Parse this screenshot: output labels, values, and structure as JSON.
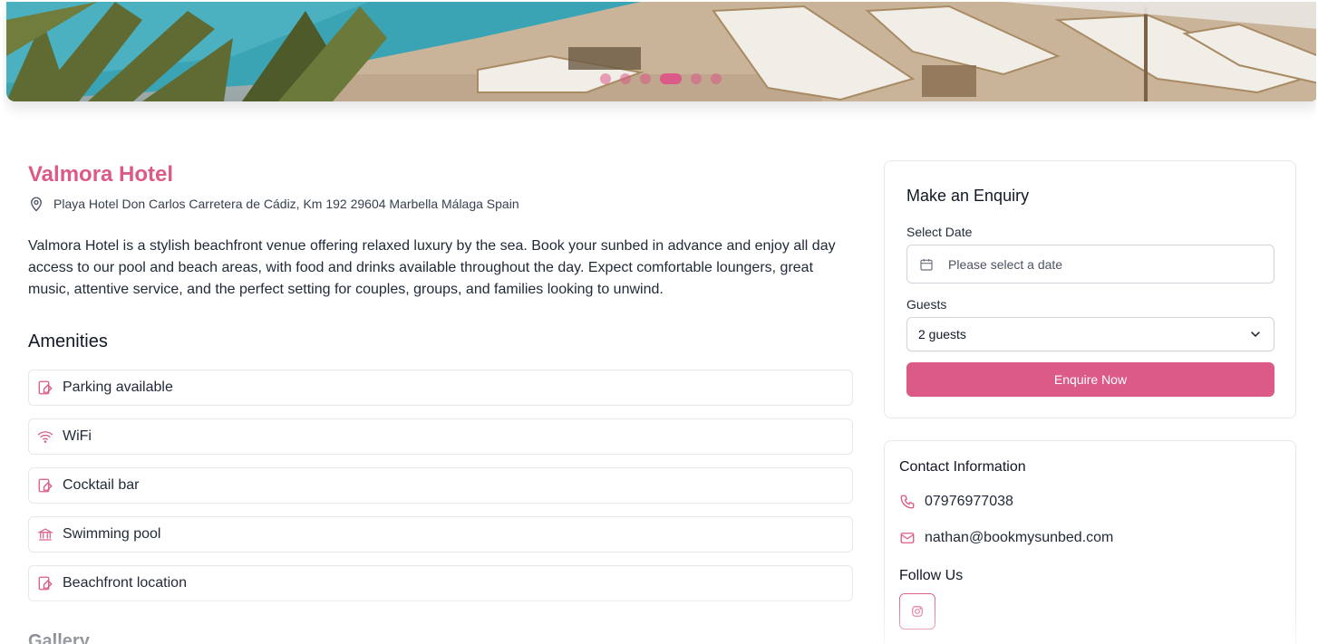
{
  "hero": {
    "carousel_dots": 6,
    "active_dot_index": 3
  },
  "venue": {
    "name": "Valmora Hotel",
    "address": "Playa Hotel Don Carlos Carretera de Cádiz, Km 192 29604 Marbella Málaga Spain",
    "description": "Valmora Hotel is a stylish beachfront venue offering relaxed luxury by the sea. Book your sunbed in advance and enjoy all day access to our pool and beach areas, with food and drinks available throughout the day. Expect comfortable loungers, great music, attentive service, and the perfect setting for couples, groups, and families looking to unwind."
  },
  "amenities": {
    "heading": "Amenities",
    "items": [
      {
        "label": "Parking available",
        "icon": "tag-icon"
      },
      {
        "label": "WiFi",
        "icon": "wifi-icon"
      },
      {
        "label": "Cocktail bar",
        "icon": "tag-icon"
      },
      {
        "label": "Swimming pool",
        "icon": "landmark-icon"
      },
      {
        "label": "Beachfront location",
        "icon": "tag-icon"
      }
    ]
  },
  "gallery": {
    "heading": "Gallery"
  },
  "enquiry": {
    "title": "Make an Enquiry",
    "date_label": "Select Date",
    "date_placeholder": "Please select a date",
    "guests_label": "Guests",
    "guests_value": "2 guests",
    "button_label": "Enquire Now"
  },
  "contact": {
    "title": "Contact Information",
    "phone": "07976977038",
    "email": "nathan@bookmysunbed.com",
    "follow_label": "Follow Us"
  },
  "colors": {
    "accent": "#db5a88",
    "text": "#1f2937",
    "border": "#e5e7eb"
  }
}
